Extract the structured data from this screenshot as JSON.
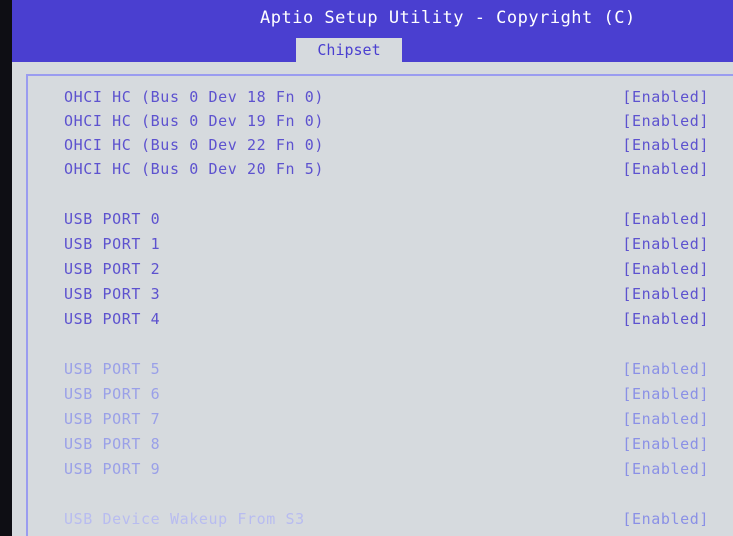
{
  "header": {
    "title": "Aptio Setup Utility - Copyright (C)",
    "active_tab": "Chipset"
  },
  "colors": {
    "header_bg": "#4a3fd0",
    "panel_bg": "#d6dade",
    "text": "#5d52cf"
  },
  "settings": [
    {
      "label": "OHCI HC (Bus 0 Dev 18 Fn 0)",
      "value": "[Enabled]"
    },
    {
      "label": "OHCI HC (Bus 0 Dev 19 Fn 0)",
      "value": "[Enabled]"
    },
    {
      "label": "OHCI HC (Bus 0 Dev 22 Fn 0)",
      "value": "[Enabled]"
    },
    {
      "label": "OHCI HC (Bus 0 Dev 20 Fn 5)",
      "value": "[Enabled]"
    },
    {
      "label": "USB PORT 0",
      "value": "[Enabled]"
    },
    {
      "label": "USB PORT 1",
      "value": "[Enabled]"
    },
    {
      "label": "USB PORT 2",
      "value": "[Enabled]"
    },
    {
      "label": "USB PORT 3",
      "value": "[Enabled]"
    },
    {
      "label": "USB PORT 4",
      "value": "[Enabled]"
    },
    {
      "label": "USB PORT 5",
      "value": "[Enabled]"
    },
    {
      "label": "USB PORT 6",
      "value": "[Enabled]"
    },
    {
      "label": "USB PORT 7",
      "value": "[Enabled]"
    },
    {
      "label": "USB PORT 8",
      "value": "[Enabled]"
    },
    {
      "label": "USB PORT 9",
      "value": "[Enabled]"
    },
    {
      "label": "USB Device Wakeup From S3",
      "value": "[Enabled]"
    }
  ]
}
